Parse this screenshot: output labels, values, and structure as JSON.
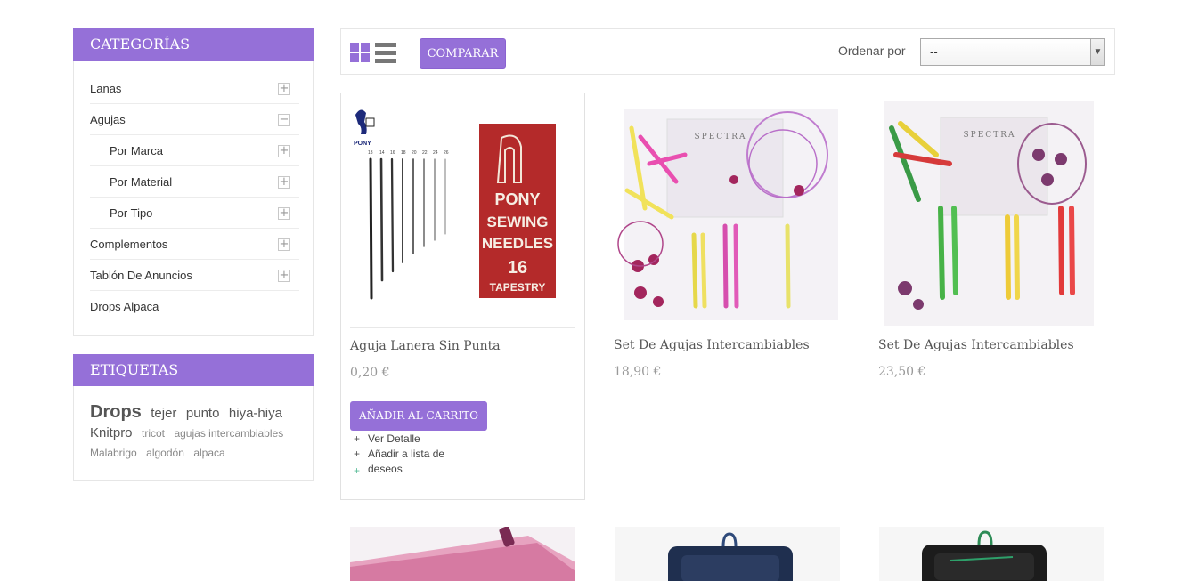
{
  "sidebar": {
    "categories_title": "CATEGORÍAS",
    "categories": [
      {
        "label": "Lanas",
        "toggle": "+"
      },
      {
        "label": "Agujas",
        "toggle": "−"
      },
      {
        "label": "Por Marca",
        "toggle": "+"
      },
      {
        "label": "Por Material",
        "toggle": "+"
      },
      {
        "label": "Por Tipo",
        "toggle": "+"
      },
      {
        "label": "Complementos",
        "toggle": "+"
      },
      {
        "label": "Tablón De Anuncios",
        "toggle": "+"
      },
      {
        "label": "Drops Alpaca"
      }
    ],
    "tags_title": "ETIQUETAS",
    "tags": [
      "Drops",
      "tejer",
      "punto",
      "hiya-hiya",
      "Knitpro",
      "tricot",
      "agujas intercambiables",
      "Malabrigo",
      "algodón",
      "alpaca"
    ]
  },
  "toolbar": {
    "view_grid_icon": "grid-icon",
    "view_list_icon": "list-icon",
    "compare_label": "COMPARAR",
    "sort_label": "Ordenar por",
    "sort_value": "--"
  },
  "products": [
    {
      "name": "Aguja Lanera Sin Punta",
      "price": "0,20 €",
      "cart_label": "AÑADIR AL CARRITO",
      "link_detail": "Ver Detalle",
      "link_wishlist": "Añadir a lista de",
      "link_wishlist_2": "deseos",
      "image": {
        "brand": "PONY",
        "line1": "PONY",
        "line2": "SEWING",
        "line3": "NEEDLES",
        "line4": "16",
        "line5": "TAPESTRY",
        "sizes": [
          "13",
          "14",
          "16",
          "18",
          "20",
          "22",
          "24",
          "26"
        ]
      }
    },
    {
      "name": "Set De Agujas Intercambiables",
      "price": "18,90 €",
      "image": {
        "brand": "SPECTRA"
      }
    },
    {
      "name": "Set De Agujas Intercambiables",
      "price": "23,50 €",
      "image": {
        "brand": "SPECTRA"
      }
    }
  ],
  "colors": {
    "accent": "#9570d8",
    "pony_red": "#b42a2a"
  }
}
